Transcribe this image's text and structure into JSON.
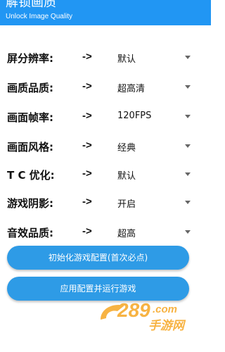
{
  "header": {
    "title": "解锁画质",
    "subtitle": "Unlock Image Quality",
    "color": "#2196f3"
  },
  "settings": [
    {
      "label": "屏分辨率:",
      "arrow": "->",
      "value": "默认"
    },
    {
      "label": "画质品质:",
      "arrow": "->",
      "value": "超高清"
    },
    {
      "label": "画面帧率:",
      "arrow": "->",
      "value": "120FPS"
    },
    {
      "label": "画面风格:",
      "arrow": "->",
      "value": "经典"
    },
    {
      "label": "T C 优化:",
      "arrow": "->",
      "value": "默认"
    },
    {
      "label": "游戏阴影:",
      "arrow": "->",
      "value": "开启"
    },
    {
      "label": "音效品质:",
      "arrow": "->",
      "value": "超高"
    }
  ],
  "buttons": {
    "init_label": "初始化游戏配置(首次必点)",
    "apply_label": "应用配置并运行游戏",
    "color": "#2e9be6"
  },
  "watermark": {
    "brand": "289",
    "domain": ".com",
    "cn_text": "手游网"
  }
}
